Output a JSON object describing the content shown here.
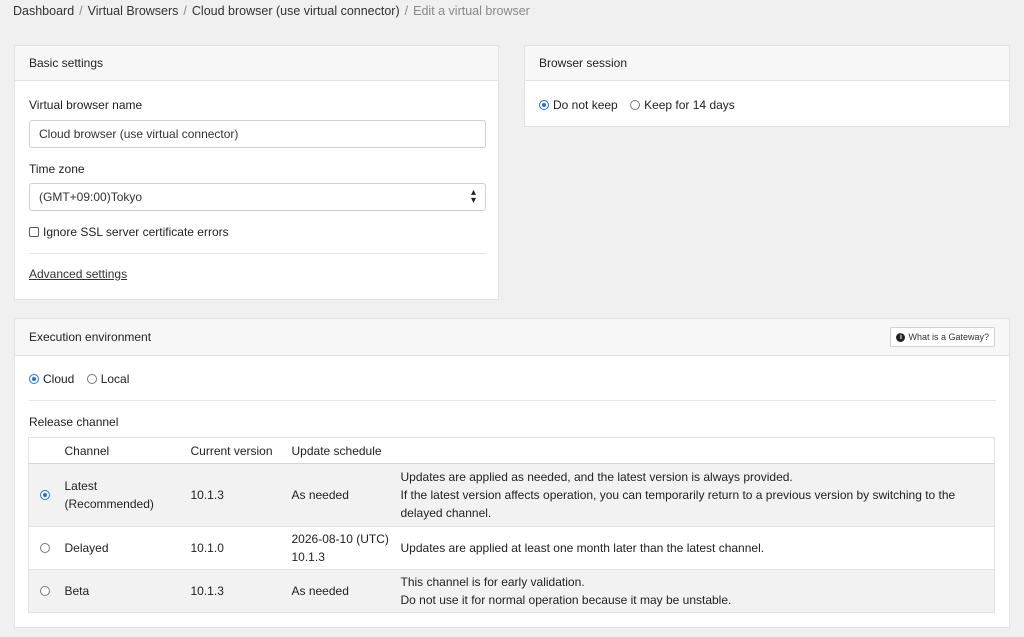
{
  "breadcrumb": {
    "items": [
      "Dashboard",
      "Virtual Browsers",
      "Cloud browser (use virtual connector)"
    ],
    "current": "Edit a virtual browser",
    "separator": "/"
  },
  "basic_settings": {
    "title": "Basic settings",
    "name_label": "Virtual browser name",
    "name_value": "Cloud browser (use virtual connector)",
    "timezone_label": "Time zone",
    "timezone_value": "(GMT+09:00)Tokyo",
    "ignore_ssl_label": "Ignore SSL server certificate errors",
    "ignore_ssl_checked": false,
    "advanced_link": "Advanced settings"
  },
  "browser_session": {
    "title": "Browser session",
    "options": [
      "Do not keep",
      "Keep for 14 days"
    ],
    "selected": "Do not keep"
  },
  "execution": {
    "title": "Execution environment",
    "gateway_button": "What is a Gateway?",
    "env_options": [
      "Cloud",
      "Local"
    ],
    "env_selected": "Cloud",
    "release_label": "Release channel",
    "table": {
      "headers": [
        "Channel",
        "Current version",
        "Update schedule"
      ],
      "rows": [
        {
          "selected": true,
          "channel_line1": "Latest",
          "channel_line2": "(Recommended)",
          "version": "10.1.3",
          "schedule_line1": "As needed",
          "schedule_line2": "",
          "desc_line1": "Updates are applied as needed, and the latest version is always provided.",
          "desc_line2": "If the latest version affects operation, you can temporarily return to a previous version by switching to the",
          "desc_line3": "delayed channel."
        },
        {
          "selected": false,
          "channel_line1": "Delayed",
          "channel_line2": "",
          "version": "10.1.0",
          "schedule_line1": "2026-08-10 (UTC)",
          "schedule_line2": "10.1.3",
          "desc_line1": "Updates are applied at least one month later than the latest channel.",
          "desc_line2": "",
          "desc_line3": ""
        },
        {
          "selected": false,
          "channel_line1": "Beta",
          "channel_line2": "",
          "version": "10.1.3",
          "schedule_line1": "As needed",
          "schedule_line2": "",
          "desc_line1": "This channel is for early validation.",
          "desc_line2": "Do not use it for normal operation because it may be unstable.",
          "desc_line3": ""
        }
      ]
    }
  },
  "colors": {
    "accent": "#1a73e8",
    "page_bg": "#f0f0f0",
    "card_header_bg": "#f7f7f7",
    "row_shade": "#f2f2f2"
  }
}
